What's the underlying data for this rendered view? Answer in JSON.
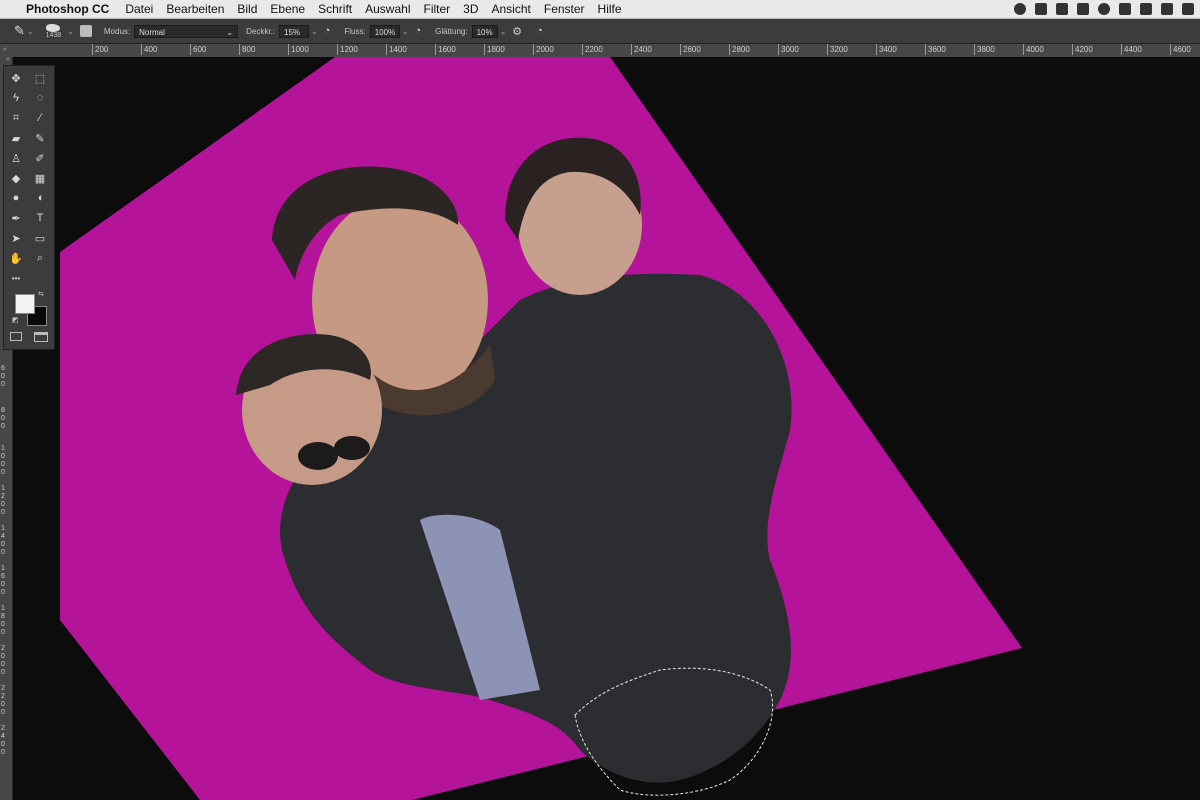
{
  "menubar": {
    "app_name": "Photoshop CC",
    "menus": [
      "Datei",
      "Bearbeiten",
      "Bild",
      "Ebene",
      "Schrift",
      "Auswahl",
      "Filter",
      "3D",
      "Ansicht",
      "Fenster",
      "Hilfe"
    ]
  },
  "options_bar": {
    "brush_size": "1438",
    "mode_label": "Modus:",
    "mode_value": "Normal",
    "opacity_label": "Deckkr.:",
    "opacity_value": "15%",
    "flow_label": "Fluss:",
    "flow_value": "100%",
    "smoothing_label": "Glättung:",
    "smoothing_value": "10%"
  },
  "ruler_top": [
    "200",
    "400",
    "600",
    "800",
    "1000",
    "1200",
    "1400",
    "1600",
    "1800",
    "2000",
    "2200",
    "2400",
    "2600",
    "2800",
    "3000",
    "3200",
    "3400",
    "3600",
    "3800",
    "4000",
    "4200",
    "4400",
    "4600"
  ],
  "ruler_left": [
    "6\n0\n0",
    "8\n0\n0",
    "1\n0\n0\n0",
    "1\n2\n0\n0",
    "1\n4\n0\n0",
    "1\n6\n0\n0",
    "1\n8\n0\n0",
    "2\n0\n0\n0",
    "2\n2\n0\n0",
    "2\n4\n0\n0"
  ],
  "tools": [
    {
      "icon": "move-icon",
      "glyph": "✥"
    },
    {
      "icon": "marquee-icon",
      "glyph": "⬚"
    },
    {
      "icon": "lasso-icon",
      "glyph": "ϟ"
    },
    {
      "icon": "quick-select-icon",
      "glyph": "◌"
    },
    {
      "icon": "crop-icon",
      "glyph": "⌗"
    },
    {
      "icon": "eyedropper-icon",
      "glyph": "⁄"
    },
    {
      "icon": "healing-icon",
      "glyph": "▰"
    },
    {
      "icon": "brush-icon",
      "glyph": "✎"
    },
    {
      "icon": "stamp-icon",
      "glyph": "♙"
    },
    {
      "icon": "history-brush-icon",
      "glyph": "✐"
    },
    {
      "icon": "eraser-icon",
      "glyph": "◆"
    },
    {
      "icon": "gradient-icon",
      "glyph": "▦"
    },
    {
      "icon": "blur-icon",
      "glyph": "●"
    },
    {
      "icon": "dodge-icon",
      "glyph": "◖"
    },
    {
      "icon": "pen-icon",
      "glyph": "✒"
    },
    {
      "icon": "type-icon",
      "glyph": "T"
    },
    {
      "icon": "path-select-icon",
      "glyph": "➤"
    },
    {
      "icon": "rectangle-icon",
      "glyph": "▭"
    },
    {
      "icon": "hand-icon",
      "glyph": "✋"
    },
    {
      "icon": "zoom-icon",
      "glyph": "⌕"
    },
    {
      "icon": "more-tools-icon",
      "glyph": "•••"
    }
  ],
  "colors": {
    "canvas_pink": "#b5149a",
    "toolbar": "#3c3c3c",
    "pasteboard": "#0c0c0c"
  }
}
